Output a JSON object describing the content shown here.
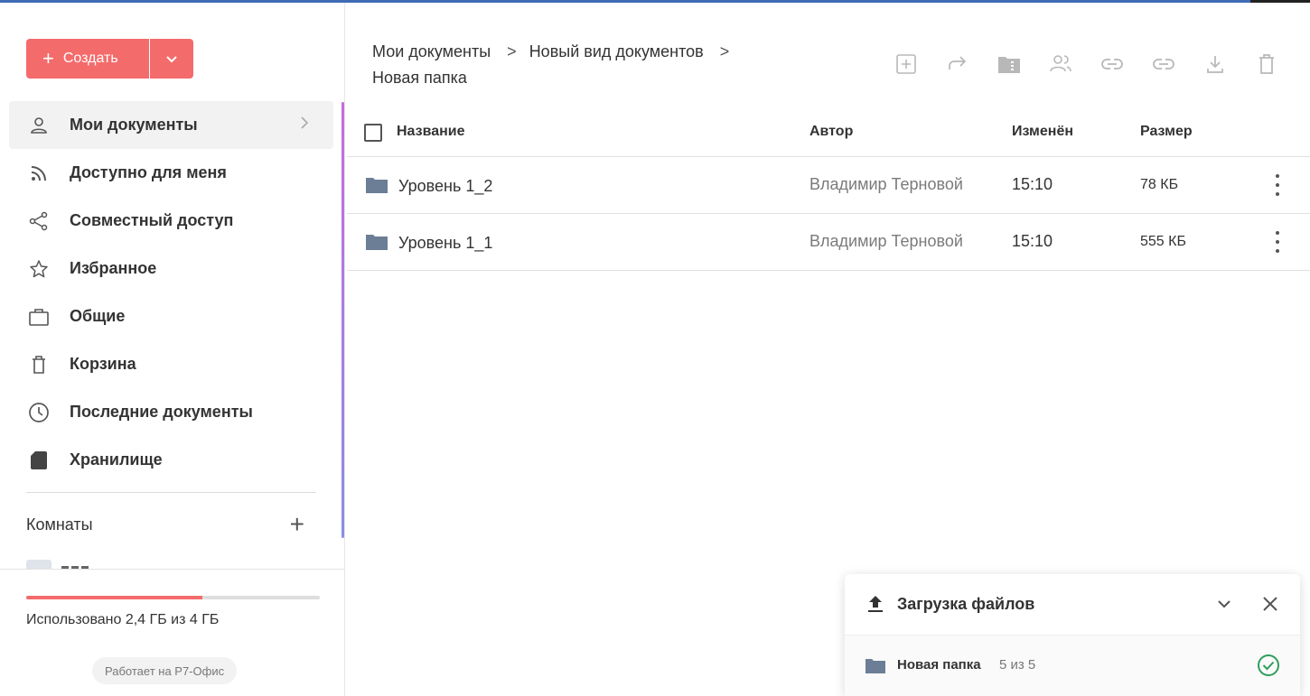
{
  "sidebar": {
    "create_label": "Создать",
    "items": [
      {
        "label": "Мои документы",
        "icon": "person-icon",
        "active": true
      },
      {
        "label": "Доступно для меня",
        "icon": "rss-icon"
      },
      {
        "label": "Совместный доступ",
        "icon": "share-icon"
      },
      {
        "label": "Избранное",
        "icon": "star-icon"
      },
      {
        "label": "Общие",
        "icon": "briefcase-icon"
      },
      {
        "label": "Корзина",
        "icon": "trash-icon"
      },
      {
        "label": "Последние документы",
        "icon": "clock-icon"
      },
      {
        "label": "Хранилище",
        "icon": "sd-card-icon"
      }
    ],
    "rooms_label": "Комнаты",
    "storage": {
      "text": "Использовано 2,4 ГБ из 4 ГБ",
      "used_fraction": 0.6
    },
    "powered_by": "Работает на Р7-Офис"
  },
  "breadcrumb": {
    "items": [
      "Мои документы",
      "Новый вид документов",
      "Новая папка"
    ]
  },
  "table": {
    "headers": {
      "name": "Название",
      "author": "Автор",
      "modified": "Изменён",
      "size": "Размер"
    },
    "rows": [
      {
        "name": "Уровень 1_2",
        "author": "Владимир Терновой",
        "modified": "15:10",
        "size": "78 КБ"
      },
      {
        "name": "Уровень 1_1",
        "author": "Владимир Терновой",
        "modified": "15:10",
        "size": "555 КБ"
      }
    ]
  },
  "upload": {
    "title": "Загрузка файлов",
    "item_name": "Новая папка",
    "item_count": "5 из 5"
  },
  "colors": {
    "accent": "#f46b6b",
    "folder": "#6b7e96",
    "success": "#2e9e5b"
  }
}
